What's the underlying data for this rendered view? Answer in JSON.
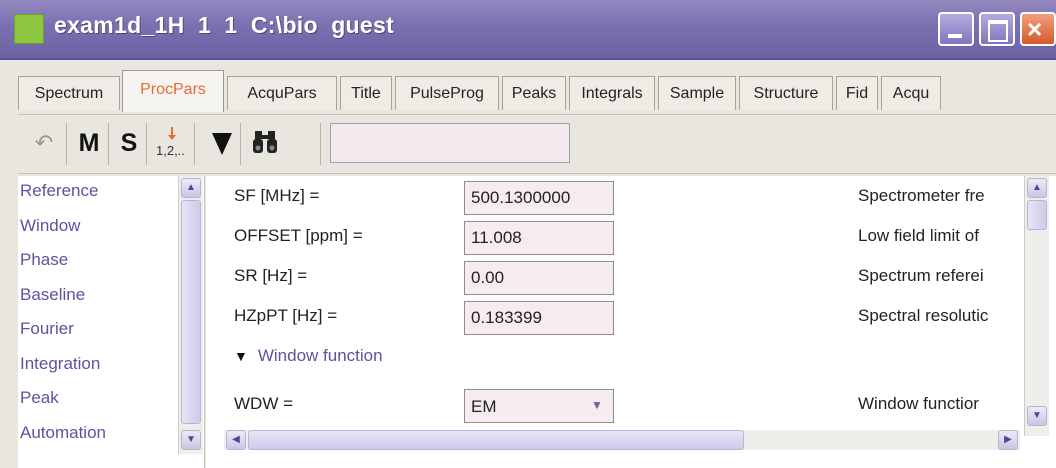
{
  "window": {
    "title": "exam1d_1H  1  1  C:\\bio  guest"
  },
  "tabs": [
    {
      "label": "Spectrum",
      "active": false
    },
    {
      "label": "ProcPars",
      "active": true
    },
    {
      "label": "AcquPars",
      "active": false
    },
    {
      "label": "Title",
      "active": false
    },
    {
      "label": "PulseProg",
      "active": false
    },
    {
      "label": "Peaks",
      "active": false
    },
    {
      "label": "Integrals",
      "active": false
    },
    {
      "label": "Sample",
      "active": false
    },
    {
      "label": "Structure",
      "active": false
    },
    {
      "label": "Fid",
      "active": false
    },
    {
      "label": "Acqu",
      "active": false
    }
  ],
  "toolbar": {
    "undo_icon": "undo-icon",
    "m_label": "M",
    "s_label": "S",
    "numbering_icon": "numbering-icon",
    "dropdown_icon": "triangle-down-icon",
    "search_icon": "binoculars-icon",
    "search_value": ""
  },
  "nav": {
    "items": [
      "Reference",
      "Window",
      "Phase",
      "Baseline",
      "Fourier",
      "Integration",
      "Peak",
      "Automation"
    ]
  },
  "params": [
    {
      "label": "SF [MHz] =",
      "value": "500.1300000",
      "desc": "Spectrometer fre"
    },
    {
      "label": "OFFSET [ppm] =",
      "value": "11.008",
      "desc": "Low field limit of"
    },
    {
      "label": "SR [Hz] =",
      "value": "0.00",
      "desc": "Spectrum referei"
    },
    {
      "label": "HZpPT [Hz] =",
      "value": "0.183399",
      "desc": "Spectral resolutic"
    }
  ],
  "section": {
    "label": "Window function"
  },
  "wdw": {
    "label": "WDW =",
    "value": "EM",
    "desc": "Window functior"
  },
  "colors": {
    "titlebar": "#7a6fb0",
    "active_tab": "#e86b3a",
    "link": "#5b54a0",
    "input_bg": "#f6ecef"
  }
}
